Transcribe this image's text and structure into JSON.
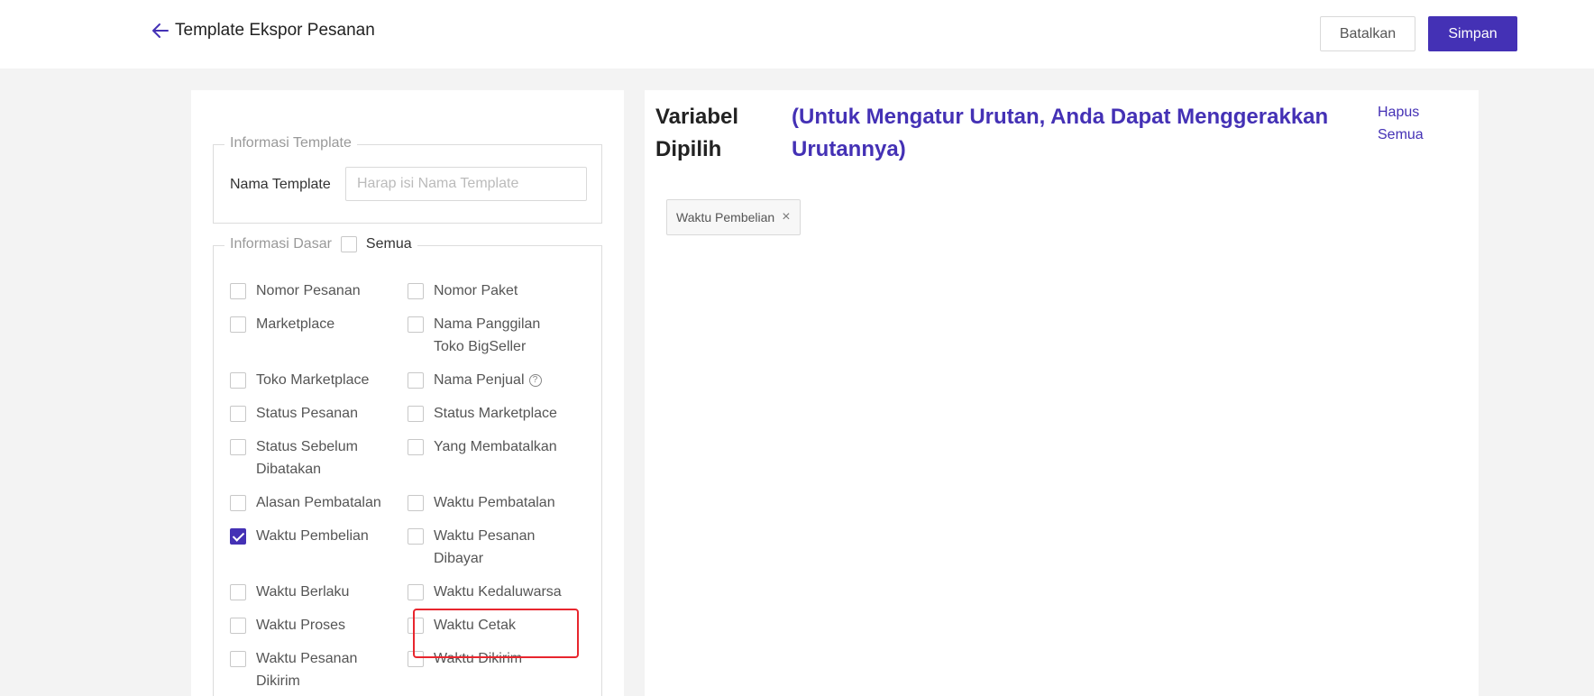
{
  "header": {
    "title": "Template Ekspor Pesanan",
    "cancel_label": "Batalkan",
    "save_label": "Simpan"
  },
  "template_info": {
    "legend": "Informasi Template",
    "name_label": "Nama Template",
    "name_placeholder": "Harap isi Nama Template",
    "name_value": ""
  },
  "basic_info": {
    "legend": "Informasi Dasar",
    "all_label": "Semua",
    "options": [
      {
        "label": "Nomor Pesanan",
        "checked": false
      },
      {
        "label": "Nomor Paket",
        "checked": false
      },
      {
        "label": "Marketplace",
        "checked": false
      },
      {
        "label": "Nama Panggilan Toko BigSeller",
        "checked": false
      },
      {
        "label": "Toko Marketplace",
        "checked": false
      },
      {
        "label": "Nama Penjual",
        "checked": false
      },
      {
        "label": "Status Pesanan",
        "checked": false
      },
      {
        "label": "Status Marketplace",
        "checked": false
      },
      {
        "label": "Status Sebelum Dibatakan",
        "checked": false
      },
      {
        "label": "Yang Membatalkan",
        "checked": false
      },
      {
        "label": "Alasan Pembatalan",
        "checked": false
      },
      {
        "label": "Waktu Pembatalan",
        "checked": false
      },
      {
        "label": "Waktu Pembelian",
        "checked": true
      },
      {
        "label": "Waktu Pesanan Dibayar",
        "checked": false
      },
      {
        "label": "Waktu Berlaku",
        "checked": false
      },
      {
        "label": "Waktu Kedaluwarsa",
        "checked": false
      },
      {
        "label": "Waktu Proses",
        "checked": false
      },
      {
        "label": "Waktu Cetak",
        "checked": false
      },
      {
        "label": "Waktu Pesanan Dikirim",
        "checked": false
      },
      {
        "label": "Waktu Dikirim",
        "checked": false
      }
    ]
  },
  "selected": {
    "title": "Variabel Dipilih",
    "note": "(Untuk Mengatur Urutan, Anda Dapat Menggerakkan Urutannya)",
    "clear_all_label": "Hapus Semua",
    "tags": [
      {
        "label": "Waktu Pembelian"
      }
    ]
  },
  "colors": {
    "brand": "#4431b5",
    "highlight": "#e8262e"
  }
}
